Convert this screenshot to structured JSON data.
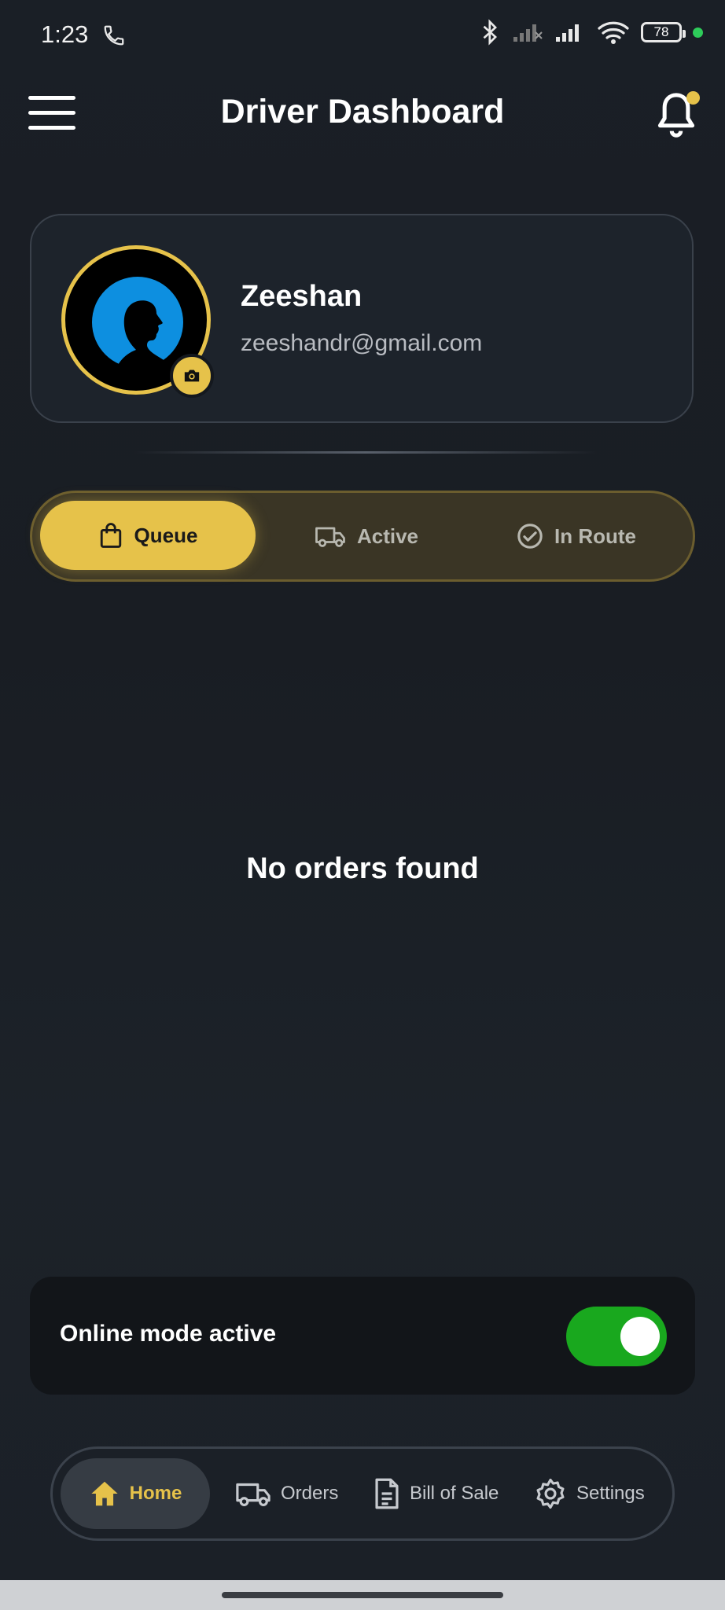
{
  "status_bar": {
    "time": "1:23",
    "battery": "78"
  },
  "header": {
    "title": "Driver Dashboard"
  },
  "profile": {
    "name": "Zeeshan",
    "email": "zeeshandr@gmail.com"
  },
  "tabs": [
    {
      "label": "Queue",
      "icon": "shopping-bag-icon",
      "active": true
    },
    {
      "label": "Active",
      "icon": "truck-icon",
      "active": false
    },
    {
      "label": "In Route",
      "icon": "check-circle-icon",
      "active": false
    }
  ],
  "empty_state": {
    "message": "No orders found"
  },
  "online": {
    "label": "Online mode active",
    "enabled": true
  },
  "nav": [
    {
      "label": "Home",
      "icon": "home-icon",
      "active": true
    },
    {
      "label": "Orders",
      "icon": "truck-icon"
    },
    {
      "label": "Bill of Sale",
      "icon": "document-icon"
    },
    {
      "label": "Settings",
      "icon": "gear-icon"
    }
  ],
  "colors": {
    "accent": "#e6c24a",
    "toggle_on": "#19a81e",
    "background": "#1a1f26"
  }
}
